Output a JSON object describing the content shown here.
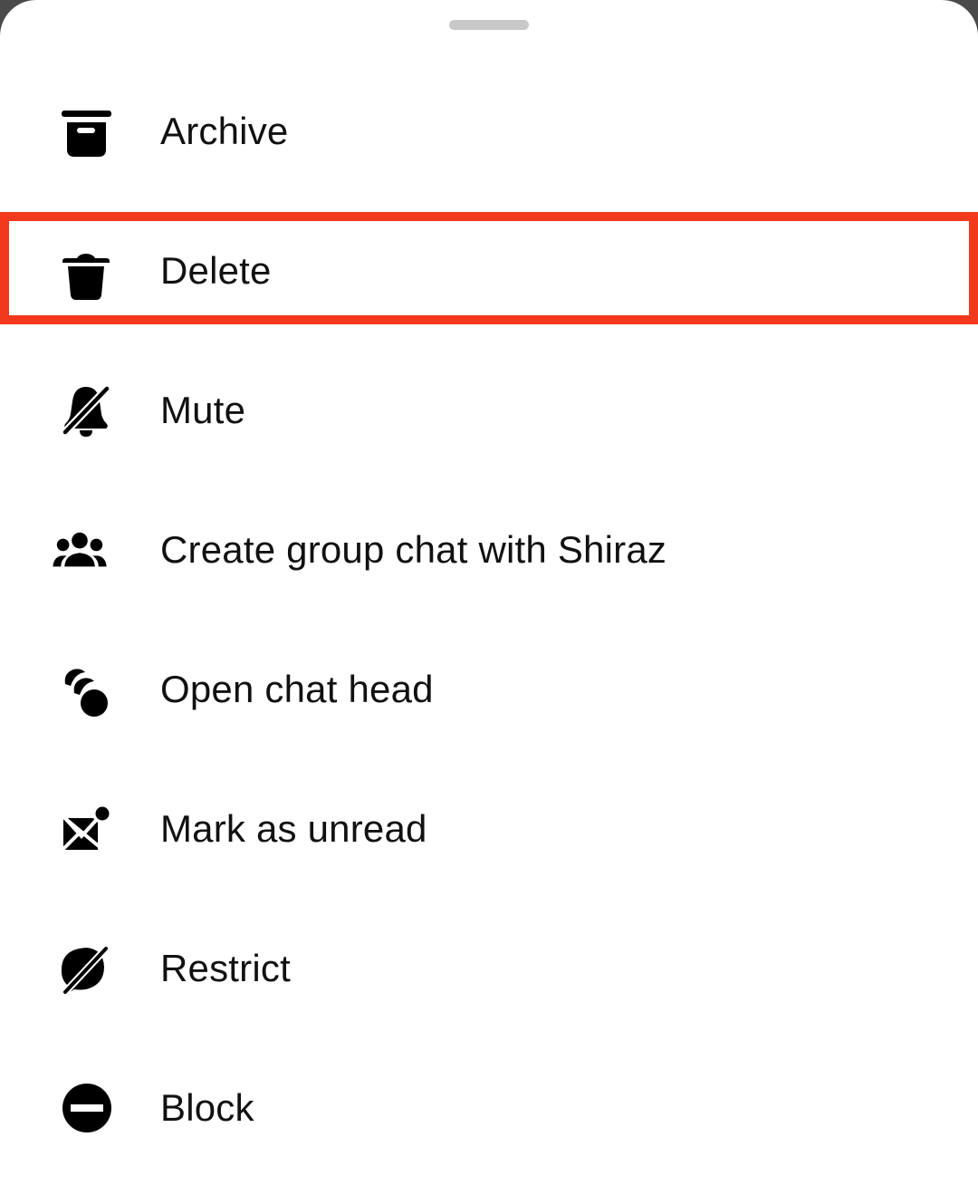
{
  "sheet": {
    "handle": "drag-handle",
    "items": [
      {
        "id": "archive",
        "label": "Archive",
        "icon": "archive-icon"
      },
      {
        "id": "delete",
        "label": "Delete",
        "icon": "trash-icon",
        "highlighted": true
      },
      {
        "id": "mute",
        "label": "Mute",
        "icon": "bell-off-icon"
      },
      {
        "id": "create-group",
        "label": "Create group chat with Shiraz",
        "icon": "group-icon"
      },
      {
        "id": "chat-head",
        "label": "Open chat head",
        "icon": "chat-head-icon"
      },
      {
        "id": "mark-unread",
        "label": "Mark as unread",
        "icon": "envelope-unread-icon"
      },
      {
        "id": "restrict",
        "label": "Restrict",
        "icon": "restrict-icon"
      },
      {
        "id": "block",
        "label": "Block",
        "icon": "block-icon"
      }
    ]
  },
  "colors": {
    "highlight": "#f2391b",
    "text": "#111111",
    "handle": "#c8c8c8"
  }
}
